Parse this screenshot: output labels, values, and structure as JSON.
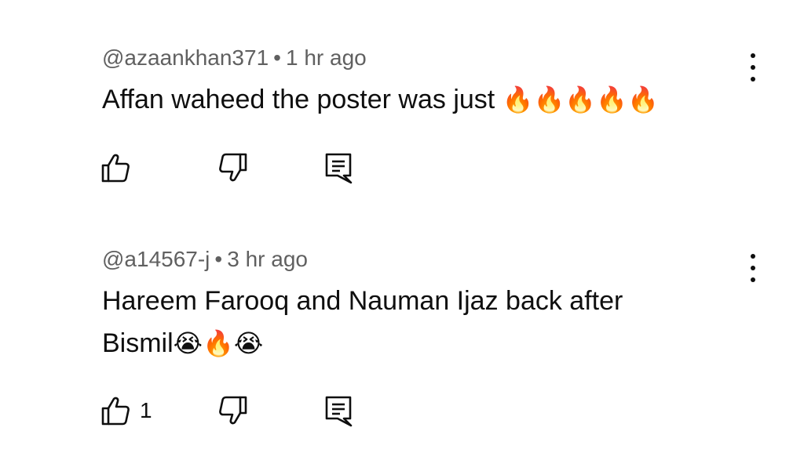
{
  "comments": [
    {
      "author": "@azaankhan371",
      "separator": "•",
      "time": "1 hr ago",
      "text": "Affan waheed the poster was just",
      "emojis": "🔥🔥🔥🔥🔥",
      "like_count": "",
      "icons": [
        "thumb-up-icon",
        "thumb-down-icon",
        "reply-icon",
        "more-vert-icon"
      ]
    },
    {
      "author": "@a14567-j",
      "separator": "•",
      "time": "3 hr ago",
      "text": "Hareem Farooq and Nauman Ijaz back after Bismil",
      "emojis": "😭🔥😭",
      "like_count": "1",
      "icons": [
        "thumb-up-icon",
        "thumb-down-icon",
        "reply-icon",
        "more-vert-icon"
      ]
    }
  ]
}
